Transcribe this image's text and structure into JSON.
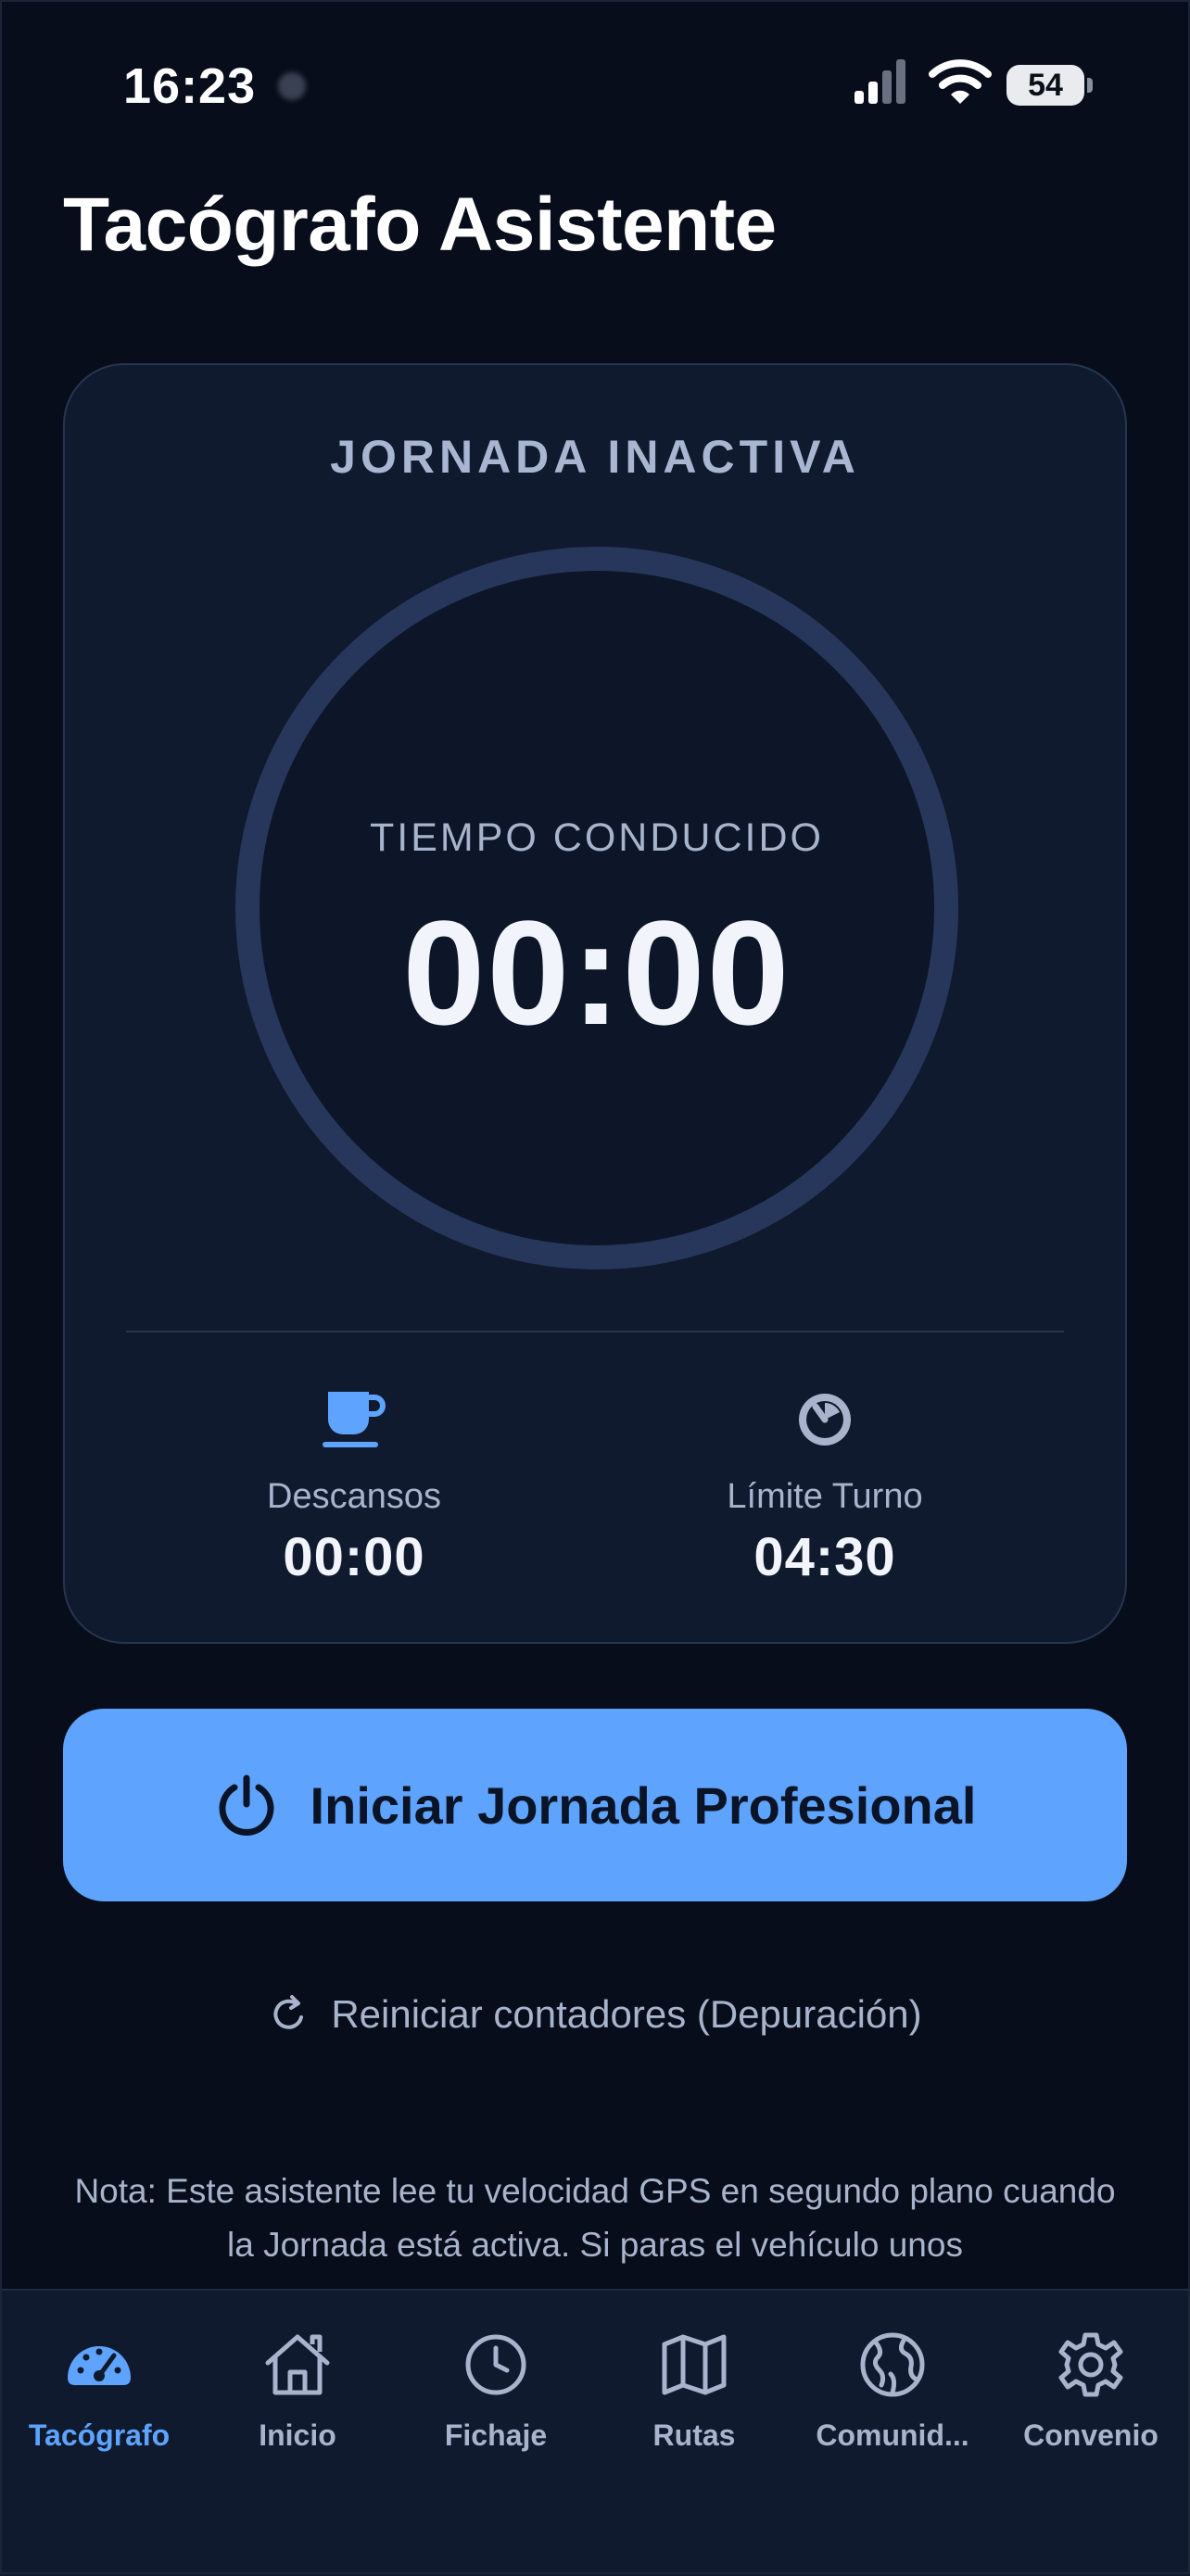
{
  "status_bar": {
    "time": "16:23",
    "battery": "54"
  },
  "app": {
    "title": "Tacógrafo Asistente"
  },
  "card": {
    "status": "JORNADA INACTIVA",
    "ring_label": "TIEMPO CONDUCIDO",
    "driving_time": "00:00",
    "breaks": {
      "label": "Descansos",
      "value": "00:00",
      "icon": "coffee-cup-icon"
    },
    "shift_limit": {
      "label": "Límite Turno",
      "value": "04:30",
      "icon": "timer-icon"
    }
  },
  "actions": {
    "start_label": "Iniciar Jornada Profesional",
    "reset_label": "Reiniciar contadores (Depuración)"
  },
  "note": "Nota: Este asistente lee tu velocidad GPS en segundo plano cuando la Jornada está activa. Si paras el vehículo unos",
  "tabs": [
    {
      "label": "Tacógrafo",
      "icon": "gauge-icon",
      "active": true
    },
    {
      "label": "Inicio",
      "icon": "home-icon",
      "active": false
    },
    {
      "label": "Fichaje",
      "icon": "clock-icon",
      "active": false
    },
    {
      "label": "Rutas",
      "icon": "map-icon",
      "active": false
    },
    {
      "label": "Comunid...",
      "icon": "globe-icon",
      "active": false
    },
    {
      "label": "Convenio",
      "icon": "gear-icon",
      "active": false
    }
  ],
  "colors": {
    "accent": "#5ea3fd",
    "background": "#070d1a",
    "card": "#101a2e",
    "muted_text": "#a8b4cc"
  }
}
